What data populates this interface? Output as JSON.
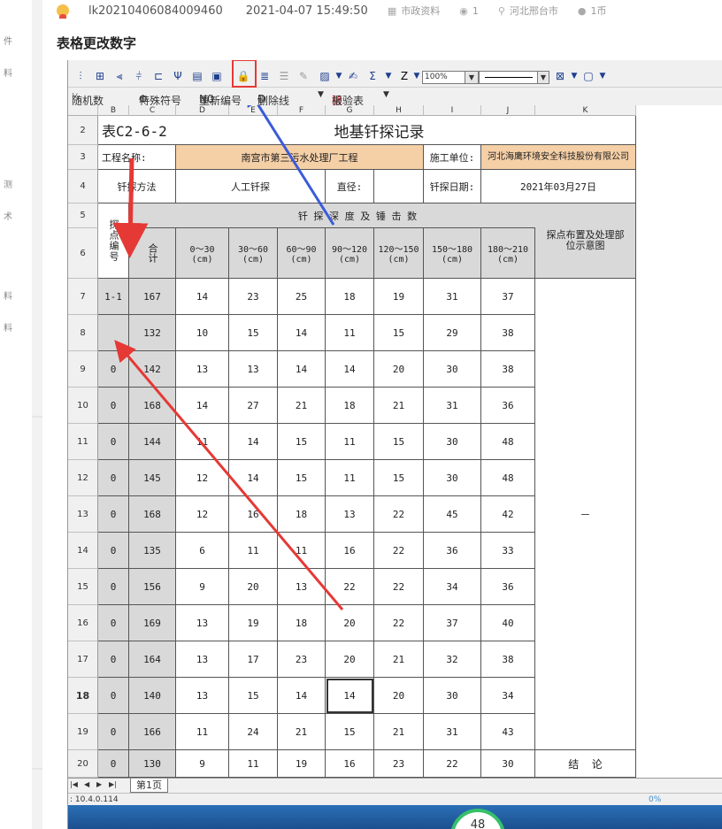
{
  "post": {
    "code": "lk20210406084009460",
    "datetime": "2021-04-07 15:49:50",
    "category": "市政资料",
    "views": "1",
    "location": "河北邢台市",
    "coins": "1币",
    "title": "表格更改数字"
  },
  "left_chars": [
    "件",
    "料",
    "测",
    "术",
    "料",
    "料"
  ],
  "toolbar2": {
    "random": "随机数",
    "special": "特殊符号",
    "renumber": "重新编号",
    "delete_line": "删除线",
    "report": "报验表"
  },
  "zoom": "100%",
  "columns": [
    "B",
    "C",
    "D",
    "E",
    "F",
    "G",
    "H",
    "I",
    "J",
    "K"
  ],
  "sheet": {
    "code": "表C2-6-2",
    "title": "地基钎探记录",
    "project_label": "工程名称:",
    "project_value": "南宫市第三污水处理厂工程",
    "contractor_label": "施工单位:",
    "contractor_value": "河北海鹰环境安全科技股份有限公司",
    "method_label": "钎探方法",
    "method_value": "人工钎探",
    "diameter_label": "直径:",
    "date_label": "钎探日期:",
    "date_value": "2021年03月27日",
    "depth_header": "钎 探 深 度 及 锤 击 数",
    "point_no": "探点编号",
    "total": "合计",
    "layout_header": "探点布置及处理部位示意图",
    "depth_cols": [
      "0～30\n(cm)",
      "30～60\n(cm)",
      "60～90\n(cm)",
      "90～120\n(cm)",
      "120～150\n(cm)",
      "150～180\n(cm)",
      "180～210\n(cm)"
    ],
    "dash": "－",
    "conclusion": "结  论"
  },
  "rows": [
    {
      "rn": "7",
      "b": "1-1",
      "c": "167",
      "v": [
        "14",
        "23",
        "25",
        "18",
        "19",
        "31",
        "37"
      ]
    },
    {
      "rn": "8",
      "b": "",
      "c": "132",
      "v": [
        "10",
        "15",
        "14",
        "11",
        "15",
        "29",
        "38"
      ]
    },
    {
      "rn": "9",
      "b": "0",
      "c": "142",
      "v": [
        "13",
        "13",
        "14",
        "14",
        "20",
        "30",
        "38"
      ]
    },
    {
      "rn": "10",
      "b": "0",
      "c": "168",
      "v": [
        "14",
        "27",
        "21",
        "18",
        "21",
        "31",
        "36"
      ]
    },
    {
      "rn": "11",
      "b": "0",
      "c": "144",
      "v": [
        "11",
        "14",
        "15",
        "11",
        "15",
        "30",
        "48"
      ]
    },
    {
      "rn": "12",
      "b": "0",
      "c": "145",
      "v": [
        "12",
        "14",
        "15",
        "11",
        "15",
        "30",
        "48"
      ]
    },
    {
      "rn": "13",
      "b": "0",
      "c": "168",
      "v": [
        "12",
        "16",
        "18",
        "13",
        "22",
        "45",
        "42"
      ]
    },
    {
      "rn": "14",
      "b": "0",
      "c": "135",
      "v": [
        "6",
        "11",
        "11",
        "16",
        "22",
        "36",
        "33"
      ]
    },
    {
      "rn": "15",
      "b": "0",
      "c": "156",
      "v": [
        "9",
        "20",
        "13",
        "22",
        "22",
        "34",
        "36"
      ]
    },
    {
      "rn": "16",
      "b": "0",
      "c": "169",
      "v": [
        "13",
        "19",
        "18",
        "20",
        "22",
        "37",
        "40"
      ]
    },
    {
      "rn": "17",
      "b": "0",
      "c": "164",
      "v": [
        "13",
        "17",
        "23",
        "20",
        "21",
        "32",
        "38"
      ]
    },
    {
      "rn": "18",
      "b": "0",
      "c": "140",
      "v": [
        "13",
        "15",
        "14",
        "14",
        "20",
        "30",
        "34"
      ]
    },
    {
      "rn": "19",
      "b": "0",
      "c": "166",
      "v": [
        "11",
        "24",
        "21",
        "15",
        "21",
        "31",
        "43"
      ]
    },
    {
      "rn": "20",
      "b": "0",
      "c": "130",
      "v": [
        "9",
        "11",
        "19",
        "16",
        "23",
        "22",
        "30"
      ]
    }
  ],
  "header_rows": [
    "2",
    "3",
    "4",
    "5",
    "6"
  ],
  "sheet_tab": "第1页",
  "status_ip": ": 10.4.0.114",
  "status_pct": "0%",
  "gauge": "48",
  "colors": {
    "tan": "#f5cfa6",
    "gray": "#d9d9d9",
    "arrow_red": "#e53935",
    "arrow_blue": "#3a5bd9"
  }
}
